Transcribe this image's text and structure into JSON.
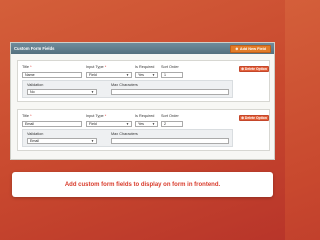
{
  "header": {
    "title": "Custom Form Fields",
    "add_label": "Add New Field",
    "add_icon": "plus-circle-icon"
  },
  "fields": [
    {
      "title_label": "Title",
      "input_type_label": "Input Type",
      "required_label": "Is Required",
      "sort_label": "Sort Order",
      "title_value": "Name",
      "input_type_value": "Field",
      "required_value": "Yes",
      "sort_value": "1",
      "delete_label": "Delete Option",
      "validation_label": "Validation",
      "validation_value": "No",
      "max_chars_label": "Max Characters",
      "max_chars_value": ""
    },
    {
      "title_label": "Title",
      "input_type_label": "Input Type",
      "required_label": "Is Required",
      "sort_label": "Sort Order",
      "title_value": "Email",
      "input_type_value": "Field",
      "required_value": "Yes",
      "sort_value": "2",
      "delete_label": "Delete Option",
      "validation_label": "Validation",
      "validation_value": "Email",
      "max_chars_label": "Max Characters",
      "max_chars_value": ""
    }
  ],
  "banner": {
    "text": "Add custom form fields to display on form in frontend."
  },
  "colors": {
    "accent": "#e27c28",
    "delete": "#e2603a",
    "header": "#5f7b8a",
    "banner_text": "#d83b2b"
  }
}
